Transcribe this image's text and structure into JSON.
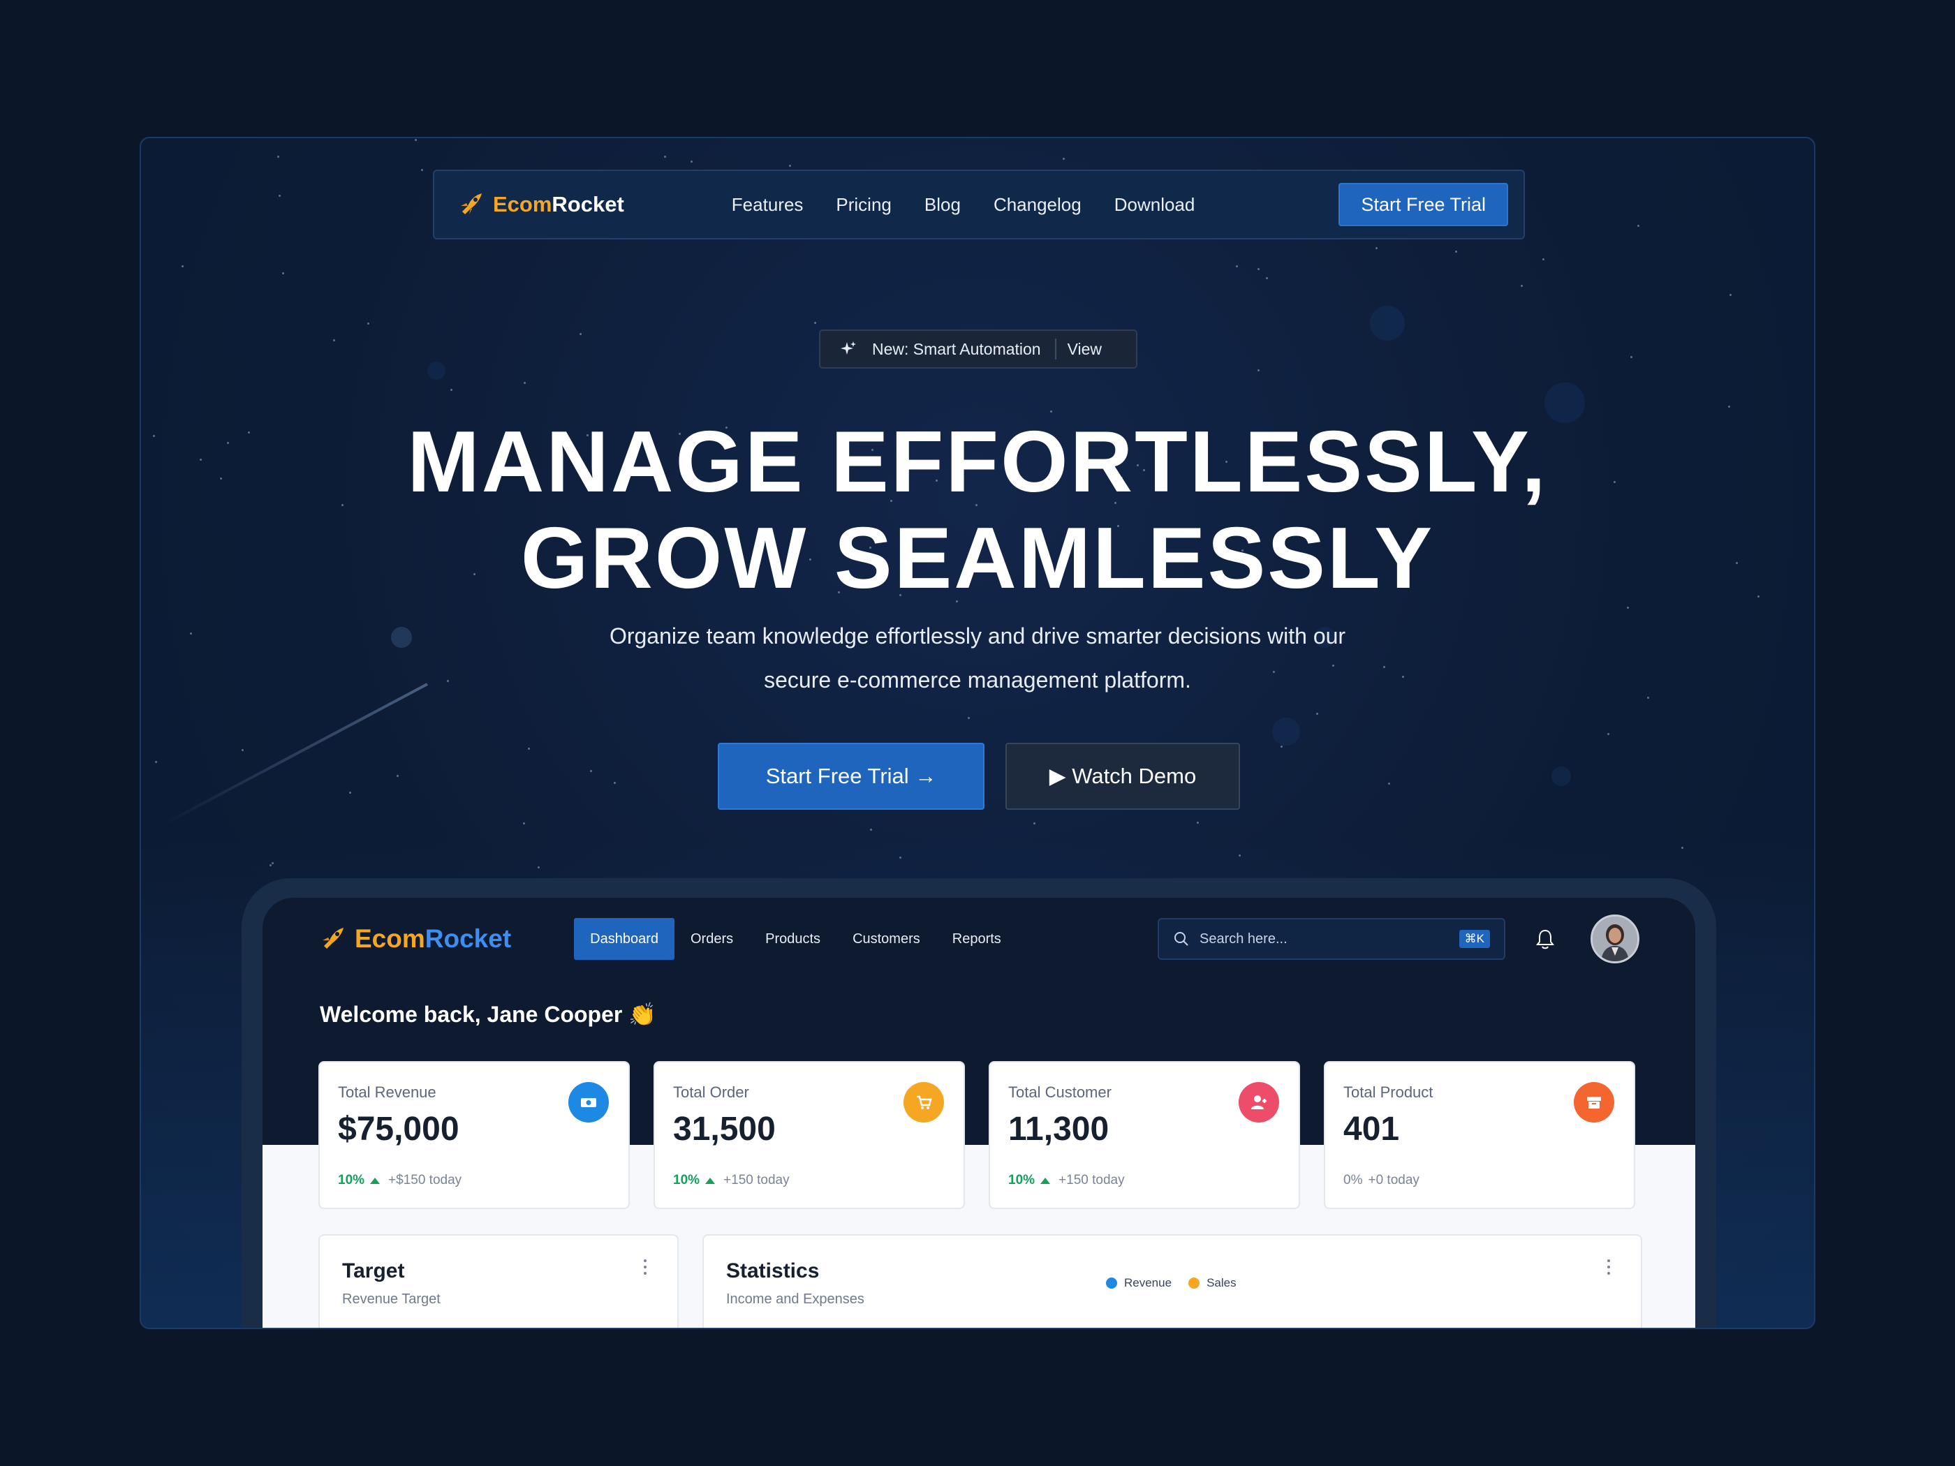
{
  "site": {
    "brand": {
      "part1": "Ecom",
      "part2": "Rocket"
    },
    "nav": [
      "Features",
      "Pricing",
      "Blog",
      "Changelog",
      "Download"
    ],
    "nav_cta": "Start Free Trial"
  },
  "announcement": {
    "text": "New: Smart Automation",
    "link": "View"
  },
  "hero": {
    "title_line1": "MANAGE EFFORTLESSLY,",
    "title_line2": "GROW SEAMLESSLY",
    "subtitle_line1": "Organize team knowledge effortlessly and drive smarter decisions with our",
    "subtitle_line2": "secure e-commerce management platform.",
    "cta_primary": "Start Free Trial →",
    "cta_secondary": "▶ Watch Demo"
  },
  "dashboard": {
    "brand": {
      "part1": "Ecom",
      "part2": "Rocket"
    },
    "nav": [
      "Dashboard",
      "Orders",
      "Products",
      "Customers",
      "Reports"
    ],
    "active_nav": "Dashboard",
    "search": {
      "placeholder": "Search here...",
      "shortcut": "⌘K"
    },
    "welcome": "Welcome back, Jane Cooper 👏",
    "cards": [
      {
        "title": "Total Revenue",
        "value": "$75,000",
        "pct": "10%",
        "delta": "+$150 today",
        "icon": "money-icon",
        "color": "#1e88e5"
      },
      {
        "title": "Total Order",
        "value": "31,500",
        "pct": "10%",
        "delta": "+150 today",
        "icon": "cart-icon",
        "color": "#f5a623"
      },
      {
        "title": "Total Customer",
        "value": "11,300",
        "pct": "10%",
        "delta": "+150 today",
        "icon": "user-add-icon",
        "color": "#ee4d6a"
      },
      {
        "title": "Total Product",
        "value": "401",
        "pct": "0%",
        "delta": "+0 today",
        "icon": "box-icon",
        "color": "#f4652f"
      }
    ],
    "target": {
      "title": "Target",
      "subtitle": "Revenue Target"
    },
    "statistics": {
      "title": "Statistics",
      "subtitle": "Income and Expenses",
      "legend": [
        {
          "label": "Revenue",
          "color": "#1e88e5"
        },
        {
          "label": "Sales",
          "color": "#f5a623"
        }
      ]
    }
  }
}
